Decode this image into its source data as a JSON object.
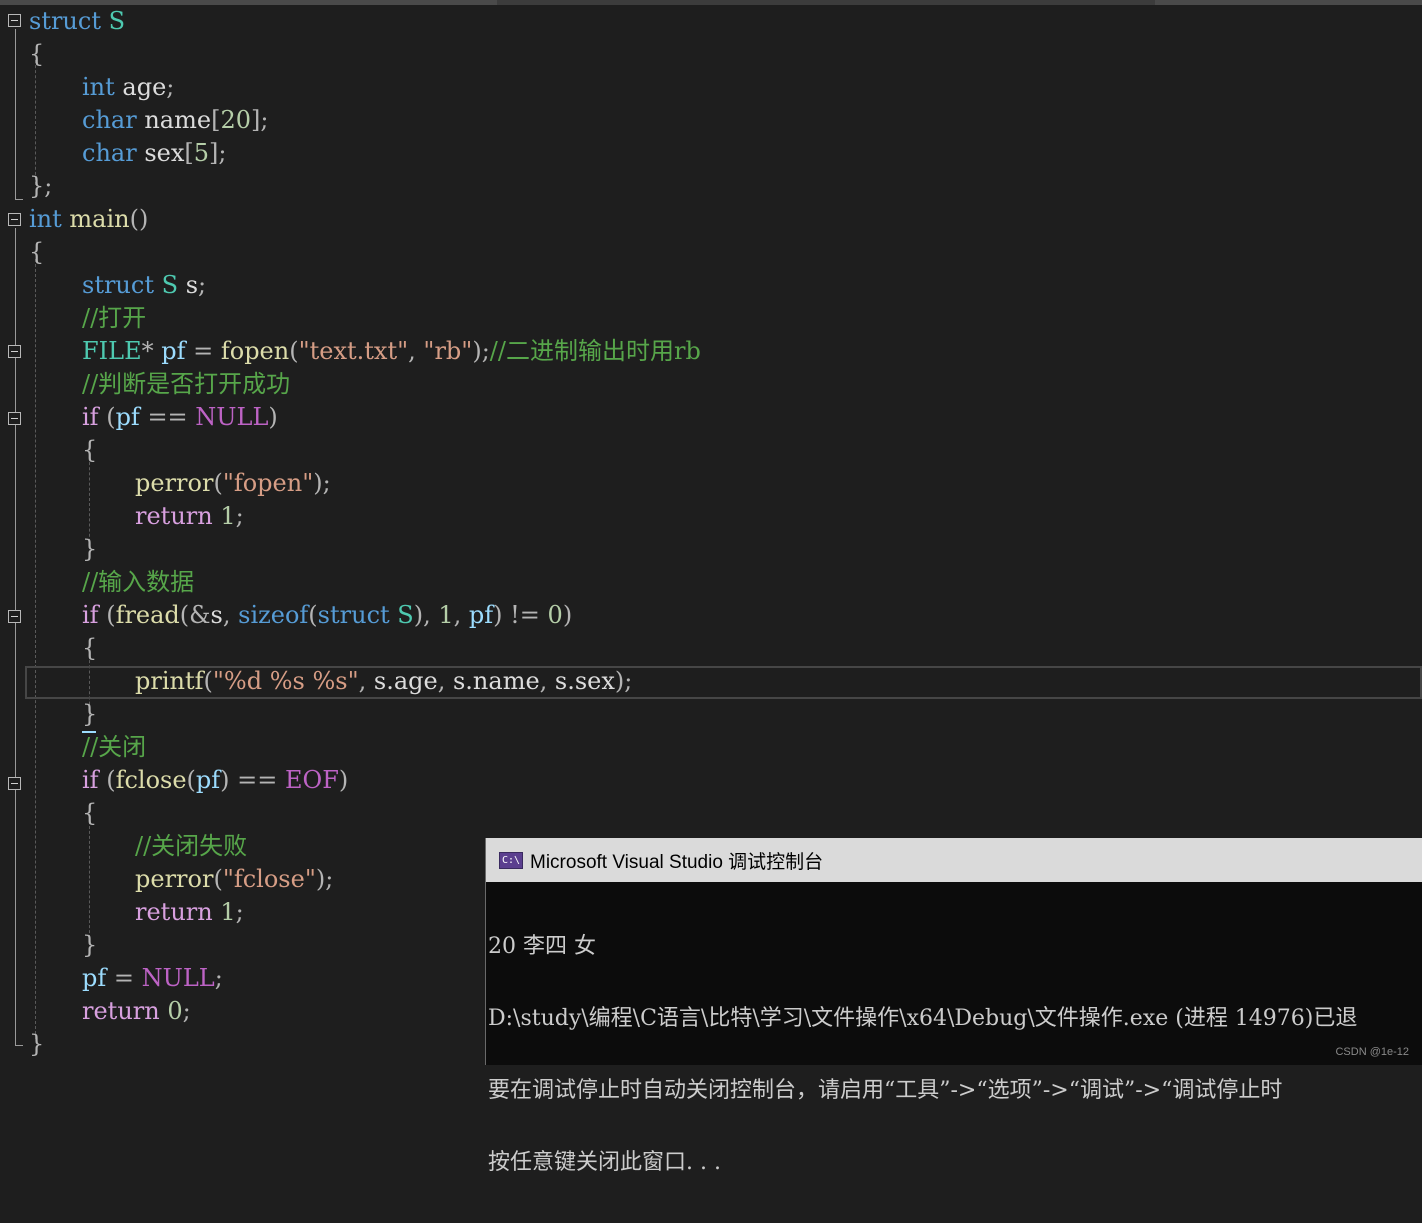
{
  "code": {
    "l1": {
      "kw": "struct",
      "name": "S"
    },
    "l2": {
      "brace": "{"
    },
    "l3": {
      "type": "int",
      "field": "age",
      "end": ";"
    },
    "l4": {
      "type": "char",
      "field": "name",
      "bl": "[",
      "num": "20",
      "br": "];"
    },
    "l5": {
      "type": "char",
      "field": "sex",
      "bl": "[",
      "num": "5",
      "br": "];"
    },
    "l6": {
      "brace": "};"
    },
    "l7": {
      "type": "int",
      "fn": "main",
      "paren": "()"
    },
    "l8": {
      "brace": "{"
    },
    "l9": {
      "kw": "struct",
      "name": "S",
      "var": "s",
      "end": ";"
    },
    "l10": {
      "comment": "//打开"
    },
    "l11": {
      "type": "FILE",
      "star": "*",
      "var": "pf",
      "eq": " = ",
      "fn": "fopen",
      "p1": "(",
      "s1": "\"text.txt\"",
      "comma": ", ",
      "s2": "\"rb\"",
      "p2": ");",
      "comment": "//二进制输出时用rb"
    },
    "l12": {
      "comment": "//判断是否打开成功"
    },
    "l13": {
      "kw": "if",
      "p1": " (",
      "var": "pf",
      "op": " == ",
      "mac": "NULL",
      "p2": ")"
    },
    "l14": {
      "brace": "{"
    },
    "l15": {
      "fn": "perror",
      "p1": "(",
      "s": "\"fopen\"",
      "p2": ");"
    },
    "l16": {
      "kw": "return",
      "num": "1",
      "end": ";"
    },
    "l17": {
      "brace": "}"
    },
    "l18": {
      "comment": "//输入数据"
    },
    "l19": {
      "kw": "if",
      "p1": " (",
      "fn": "fread",
      "p2": "(&",
      "v1": "s",
      "c1": ", ",
      "kw2": "sizeof",
      "p3": "(",
      "kw3": "struct",
      "sp": " ",
      "name": "S",
      "p4": "), ",
      "num1": "1",
      "c2": ", ",
      "v2": "pf",
      "p5": ") != ",
      "num2": "0",
      "p6": ")"
    },
    "l20": {
      "brace": "{"
    },
    "l21": {
      "fn": "printf",
      "p1": "(",
      "s": "\"%d %s %s\"",
      "c1": ", ",
      "a1": "s.age",
      "c2": ", ",
      "a2": "s.name",
      "c3": ", ",
      "a3": "s.sex",
      "p2": ");"
    },
    "l22": {
      "brace": "}"
    },
    "l23": {
      "comment": "//关闭"
    },
    "l24": {
      "kw": "if",
      "p1": " (",
      "fn": "fclose",
      "p2": "(",
      "var": "pf",
      "p3": ") == ",
      "mac": "EOF",
      "p4": ")"
    },
    "l25": {
      "brace": "{"
    },
    "l26": {
      "comment": "//关闭失败"
    },
    "l27": {
      "fn": "perror",
      "p1": "(",
      "s": "\"fclose\"",
      "p2": ");"
    },
    "l28": {
      "kw": "return",
      "num": "1",
      "end": ";"
    },
    "l29": {
      "brace": "}"
    },
    "l30": {
      "var": "pf",
      "eq": " = ",
      "mac": "NULL",
      "end": ";"
    },
    "l31": {
      "kw": "return",
      "num": "0",
      "end": ";"
    },
    "l32": {
      "brace": "}"
    }
  },
  "console": {
    "title": "Microsoft Visual Studio 调试控制台",
    "icon_text": "C:\\",
    "lines": [
      "20 李四 女",
      "D:\\study\\编程\\C语言\\比特\\学习\\文件操作\\x64\\Debug\\文件操作.exe (进程 14976)已退",
      "要在调试停止时自动关闭控制台，请启用“工具”->“选项”->“调试”->“调试停止时",
      "按任意键关闭此窗口. . ."
    ]
  },
  "watermark": "CSDN @1e-12"
}
